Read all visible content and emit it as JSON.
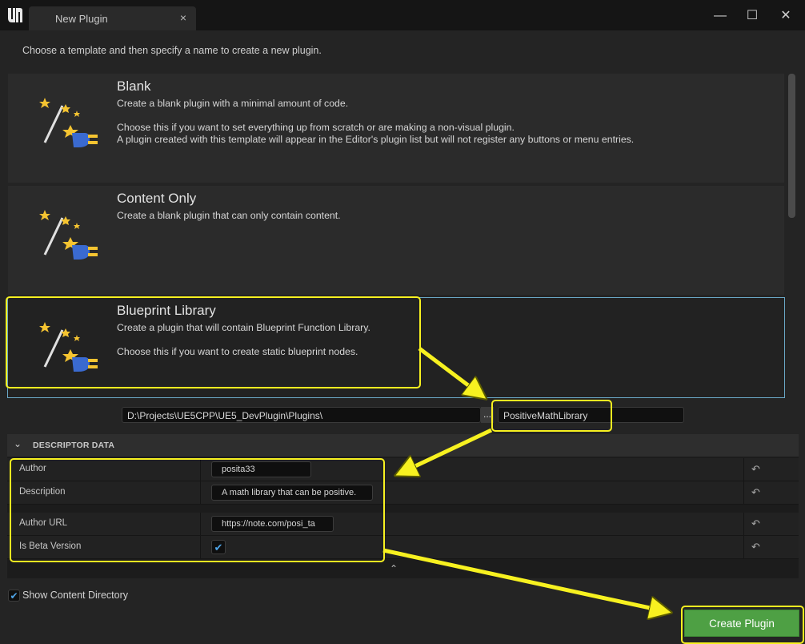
{
  "window": {
    "tab_title": "New Plugin",
    "close_glyph": "×",
    "minimize_glyph": "—",
    "maximize_glyph": "☐",
    "window_close_glyph": "✕"
  },
  "instructions": "Choose a template and then specify a name to create a new plugin.",
  "templates": [
    {
      "name": "Blank",
      "lines": [
        "Create a blank plugin with a minimal amount of code.",
        "Choose this if you want to set everything up from scratch or are making a non-visual plugin.",
        "A plugin created with this template will appear in the Editor's plugin list but will not register any buttons or menu entries."
      ],
      "icon": "plugin-wand-icon"
    },
    {
      "name": "Content Only",
      "lines": [
        "Create a blank plugin that can only contain content."
      ],
      "icon": "plugin-wand-icon"
    },
    {
      "name": "Blueprint Library",
      "lines": [
        "Create a plugin that will contain Blueprint Function Library.",
        "Choose this if you want to create static blueprint nodes."
      ],
      "icon": "plugin-wand-icon",
      "selected": true
    }
  ],
  "path": {
    "value": "D:\\Projects\\UE5CPP\\UE5_DevPlugin\\Plugins\\",
    "browse_label": "...",
    "plugin_name": "PositiveMathLibrary"
  },
  "descriptor": {
    "header": "DESCRIPTOR DATA",
    "chevron_glyph": "⌄",
    "reset_glyph": "↶",
    "check_glyph": "✔",
    "author": {
      "label": "Author",
      "value": "posita33"
    },
    "description": {
      "label": "Description",
      "value": "A math library that can be positive."
    },
    "author_url": {
      "label": "Author URL",
      "value": "https://note.com/posi_ta"
    },
    "is_beta": {
      "label": "Is Beta Version",
      "checked": true
    },
    "collapse_glyph": "⌃"
  },
  "show_content": {
    "label": "Show Content Directory",
    "checked": true
  },
  "create_button": "Create Plugin",
  "colors": {
    "highlight": "#f7f120",
    "create_button": "#4ea044",
    "selection_outline": "#6aa8c6",
    "check": "#4fa6ea"
  }
}
